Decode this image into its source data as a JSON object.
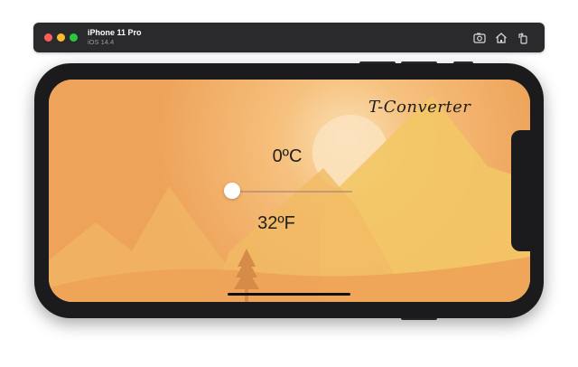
{
  "simulator": {
    "device_name": "iPhone 11 Pro",
    "os_version": "iOS 14.4",
    "toolbar_icons": [
      "screenshot-icon",
      "home-icon",
      "rotate-icon"
    ]
  },
  "app": {
    "title": "T-Converter",
    "celsius_value": "0ºC",
    "fahrenheit_value": "32ºF",
    "slider_position": 0
  },
  "colors": {
    "background_orange": "#eea35a",
    "mountain_yellow": "#f3c766",
    "sun": "#fbe3c0",
    "window_chrome": "#2a2a2c",
    "device_body": "#1b1b1d"
  }
}
